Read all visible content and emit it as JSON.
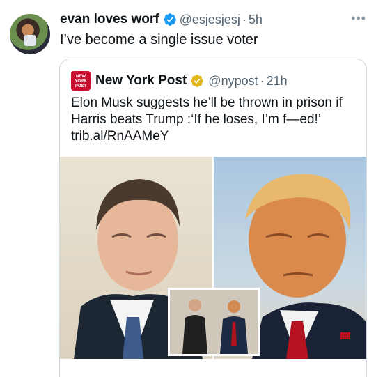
{
  "tweet": {
    "author_name": "evan loves worf",
    "handle": "@esjesjesj",
    "separator": "·",
    "time": "5h",
    "text": "I’ve become a single issue voter"
  },
  "quote": {
    "logo_text": "NEW YORK POST",
    "name": "New York Post",
    "handle": "@nypost",
    "separator": "·",
    "time": "21h",
    "text": "Elon Musk suggests he’ll be thrown in prison if Harris beats Trump :‘If he loses, I’m f—ed!’",
    "link": "trib.al/RnAAMeY"
  },
  "media": {
    "left_image": "elon-musk-photo",
    "right_image": "donald-trump-photo",
    "inset_image": "musk-and-trump-photo"
  },
  "icons": {
    "verified_blue": "#1d9bf0",
    "verified_gold": "#e2b719",
    "more": "more-icon"
  },
  "colors": {
    "secondary_text": "#536471",
    "border": "#cfd9de",
    "nyp_red": "#c8102e"
  }
}
